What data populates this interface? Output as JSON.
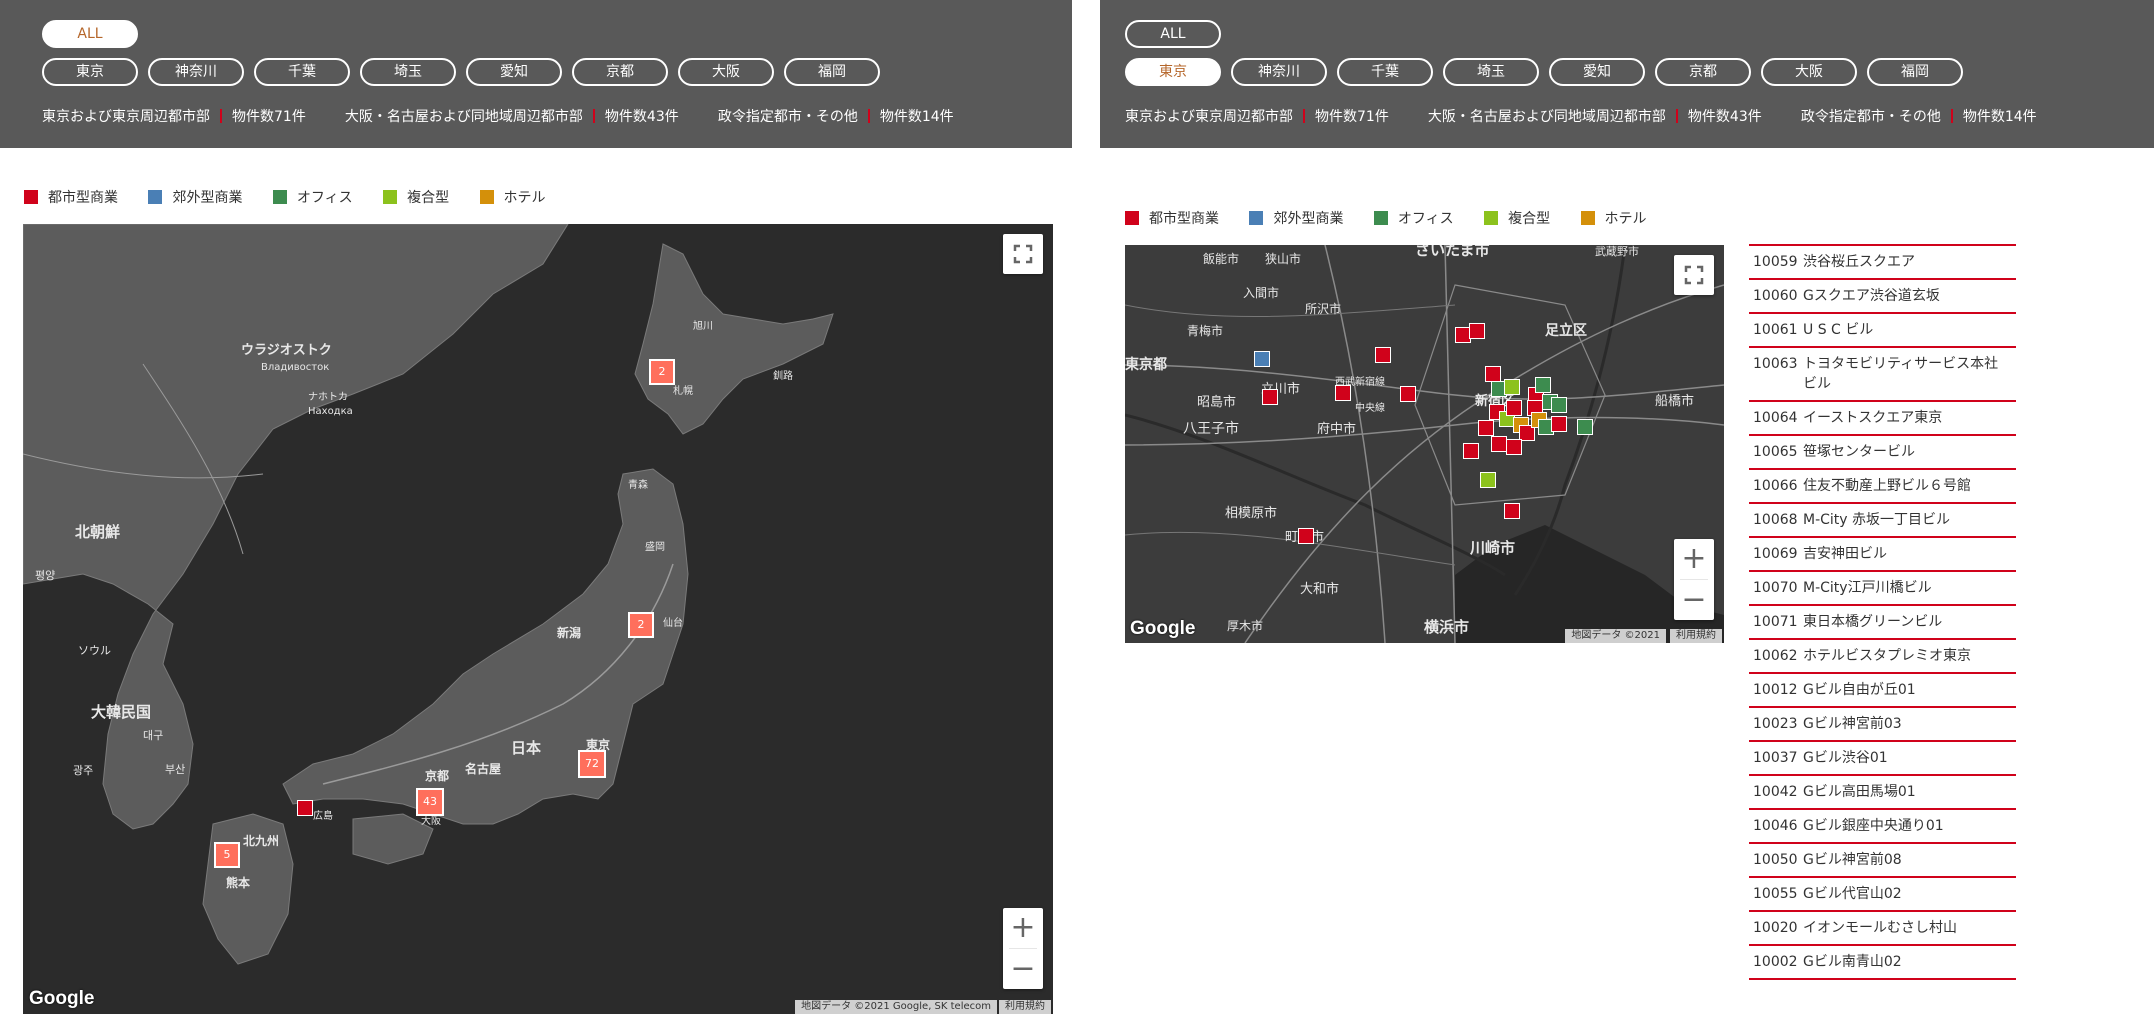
{
  "left": {
    "all_label": "ALL",
    "prefectures": [
      "東京",
      "神奈川",
      "千葉",
      "埼玉",
      "愛知",
      "京都",
      "大阪",
      "福岡"
    ],
    "summary": [
      {
        "region": "東京および東京周辺都市部",
        "count": "物件数71件"
      },
      {
        "region": "大阪・名古屋および同地域周辺都市部",
        "count": "物件数43件"
      },
      {
        "region": "政令指定都市・その他",
        "count": "物件数14件"
      }
    ],
    "legend": [
      {
        "label": "都市型商業",
        "color": "#d0021b"
      },
      {
        "label": "郊外型商業",
        "color": "#4a7fb5"
      },
      {
        "label": "オフィス",
        "color": "#3d8c4f"
      },
      {
        "label": "複合型",
        "color": "#8cc21d"
      },
      {
        "label": "ホテル",
        "color": "#d4900a"
      }
    ],
    "map": {
      "labels": [
        "ウラジオストク",
        "Владивосток",
        "ナホトカ",
        "Находка",
        "北朝鮮",
        "大韓民国",
        "日本",
        "新潟",
        "名古屋",
        "京都",
        "東京",
        "北九州",
        "熊本",
        "ソウル",
        "대구",
        "광주",
        "부산",
        "평양",
        "札幌",
        "旭川",
        "釧路",
        "青森",
        "盛岡",
        "仙台",
        "大阪",
        "広島"
      ],
      "clusters": [
        "2",
        "2",
        "43",
        "72",
        "5"
      ],
      "google_logo": "Google",
      "attribution": "地図データ ©2021 Google, SK telecom",
      "terms": "利用規約"
    }
  },
  "right": {
    "all_label": "ALL",
    "prefectures": [
      "東京",
      "神奈川",
      "千葉",
      "埼玉",
      "愛知",
      "京都",
      "大阪",
      "福岡"
    ],
    "active_prefecture": "東京",
    "summary": [
      {
        "region": "東京および東京周辺都市部",
        "count": "物件数71件"
      },
      {
        "region": "大阪・名古屋および同地域周辺都市部",
        "count": "物件数43件"
      },
      {
        "region": "政令指定都市・その他",
        "count": "物件数14件"
      }
    ],
    "legend": [
      {
        "label": "都市型商業",
        "color": "#d0021b"
      },
      {
        "label": "郊外型商業",
        "color": "#4a7fb5"
      },
      {
        "label": "オフィス",
        "color": "#3d8c4f"
      },
      {
        "label": "複合型",
        "color": "#8cc21d"
      },
      {
        "label": "ホテル",
        "color": "#d4900a"
      }
    ],
    "map": {
      "labels": [
        "さいたま市",
        "飯能市",
        "狭山市",
        "入間市",
        "所沢市",
        "青梅市",
        "足立区",
        "武蔵野市",
        "立川市",
        "昭島市",
        "八王子市",
        "府中市",
        "中央線",
        "新宿区",
        "相模原市",
        "町田市",
        "川崎市",
        "大和市",
        "横浜市",
        "船橋市",
        "厚木市",
        "東京都",
        "西武新宿線"
      ],
      "google_logo": "Google",
      "attribution": "地図データ ©2021",
      "terms": "利用規約"
    },
    "properties": [
      {
        "id": "10059",
        "name": "渋谷桜丘スクエア"
      },
      {
        "id": "10060",
        "name": "Gスクエア渋谷道玄坂"
      },
      {
        "id": "10061",
        "name": "U S C ビル"
      },
      {
        "id": "10063",
        "name": "トヨタモビリティサービス本社ビル"
      },
      {
        "id": "10064",
        "name": "イーストスクエア東京"
      },
      {
        "id": "10065",
        "name": "笹塚センタービル"
      },
      {
        "id": "10066",
        "name": "住友不動産上野ビル６号館"
      },
      {
        "id": "10068",
        "name": "M-City 赤坂一丁目ビル"
      },
      {
        "id": "10069",
        "name": "吉安神田ビル"
      },
      {
        "id": "10070",
        "name": "M-City江戸川橋ビル"
      },
      {
        "id": "10071",
        "name": "東日本橋グリーンビル"
      },
      {
        "id": "10062",
        "name": "ホテルビスタプレミオ東京"
      },
      {
        "id": "10012",
        "name": "Gビル自由が丘01"
      },
      {
        "id": "10023",
        "name": "Gビル神宮前03"
      },
      {
        "id": "10037",
        "name": "Gビル渋谷01"
      },
      {
        "id": "10042",
        "name": "Gビル高田馬場01"
      },
      {
        "id": "10046",
        "name": "Gビル銀座中央通り01"
      },
      {
        "id": "10050",
        "name": "Gビル神宮前08"
      },
      {
        "id": "10055",
        "name": "Gビル代官山02"
      },
      {
        "id": "10020",
        "name": "イオンモールむさし村山"
      },
      {
        "id": "10002",
        "name": "Gビル南青山02"
      }
    ]
  }
}
